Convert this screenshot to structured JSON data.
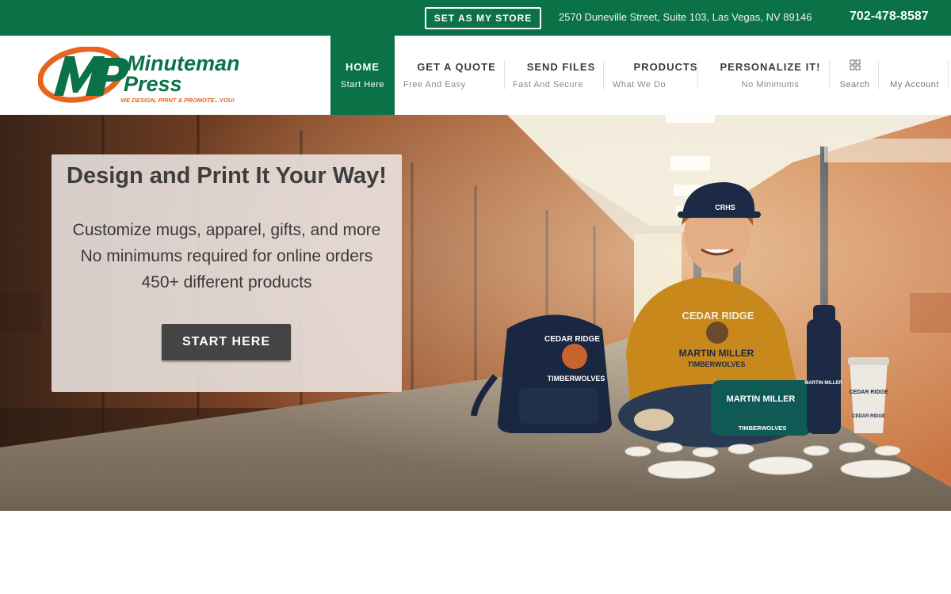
{
  "topbar": {
    "store_button": "SET AS MY STORE",
    "address": "2570 Duneville Street, Suite 103, Las Vegas, NV 89146",
    "phone": "702-478-8587"
  },
  "logo": {
    "line1": "Minuteman",
    "line2": "Press",
    "tagline": "WE DESIGN, PRINT & PROMOTE...YOU!"
  },
  "nav": {
    "items": [
      {
        "title": "HOME",
        "subtitle": "Start Here"
      },
      {
        "title": "GET A QUOTE",
        "subtitle": "Free And Easy"
      },
      {
        "title": "SEND FILES",
        "subtitle": "Fast And Secure"
      },
      {
        "title": "PRODUCTS",
        "subtitle": "What We Do"
      },
      {
        "title": "PERSONALIZE IT!",
        "subtitle": "No Minimums"
      }
    ],
    "search_label": "Search",
    "account_label": "My Account"
  },
  "hero": {
    "title": "Design and Print It Your Way!",
    "lines": [
      "Customize mugs, apparel, gifts, and more",
      "No minimums required for online orders",
      "450+ different products"
    ],
    "button": "START HERE",
    "cap_text": "CRHS",
    "hoodie_text1": "CEDAR RIDGE",
    "hoodie_text2": "MARTIN MILLER",
    "hoodie_text3": "TIMBERWOLVES",
    "backpack_text1": "CEDAR RIDGE",
    "backpack_text2": "TIMBERWOLVES",
    "pouch_text1": "MARTIN MILLER",
    "pouch_text2": "TIMBERWOLVES",
    "bottle_text": "MARTIN MILLER",
    "tumbler_text1": "CEDAR RIDGE",
    "tumbler_text2": "CEDAR RIDGE"
  },
  "colors": {
    "brand_green": "#0b7146",
    "logo_orange": "#e8641f",
    "button_dark": "#444444"
  }
}
